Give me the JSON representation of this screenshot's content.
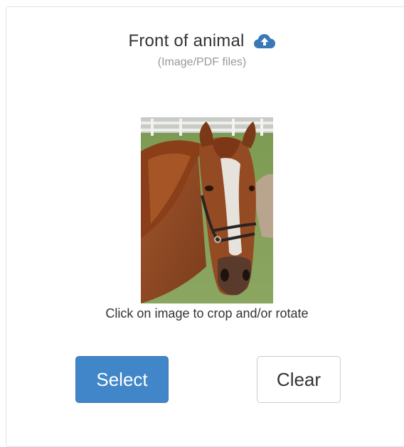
{
  "upload": {
    "title": "Front of animal",
    "subtitle": "(Image/PDF files)",
    "icon": "cloud-upload-icon",
    "caption": "Click on image to crop and/or rotate"
  },
  "actions": {
    "select_label": "Select",
    "clear_label": "Clear"
  },
  "colors": {
    "accent": "#4186c8",
    "title_text": "#333333",
    "muted_text": "#999999",
    "border": "#cccccc"
  }
}
